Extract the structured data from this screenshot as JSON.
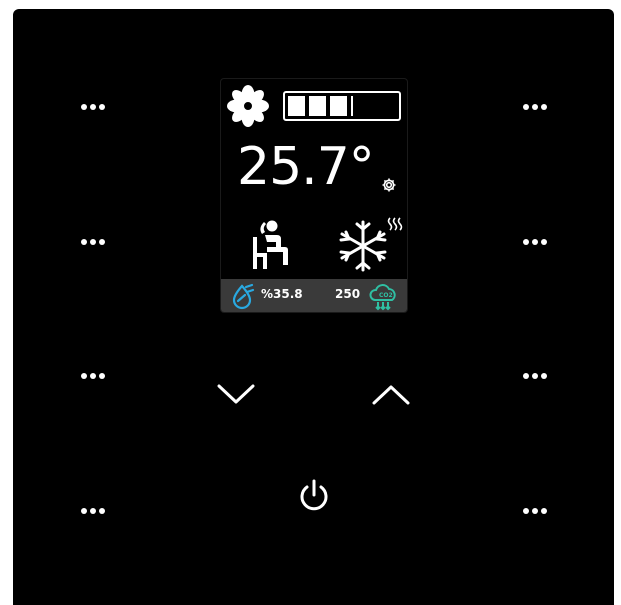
{
  "thermostat": {
    "temperature": "25.7°",
    "humidity": "%35.8",
    "co2": "250",
    "fan_speed_level": 0.6,
    "mode": "cool",
    "preset": "comfort"
  },
  "icons": {
    "fan": "fan-icon",
    "settings": "gear-icon",
    "person": "seated-person-icon",
    "snowflake": "snowflake-icon",
    "heat_waves": "heat-waves-icon",
    "humidity": "water-drop-icon",
    "co2": "co2-cloud-icon",
    "up": "chevron-up-icon",
    "down": "chevron-down-icon",
    "power": "power-icon",
    "more": "ellipsis-icon"
  },
  "colors": {
    "panel": "#000000",
    "foreground": "#ffffff",
    "status_bar": "#3a3a3a",
    "humidity_accent": "#29a9e1",
    "co2_accent": "#2fbfa3"
  }
}
